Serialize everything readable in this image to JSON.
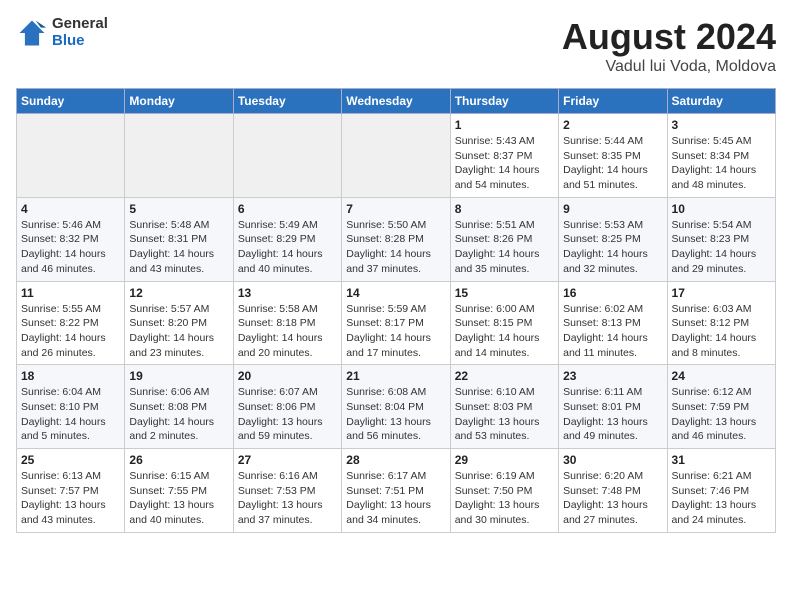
{
  "logo": {
    "general": "General",
    "blue": "Blue"
  },
  "title": "August 2024",
  "subtitle": "Vadul lui Voda, Moldova",
  "headers": [
    "Sunday",
    "Monday",
    "Tuesday",
    "Wednesday",
    "Thursday",
    "Friday",
    "Saturday"
  ],
  "weeks": [
    [
      {
        "num": "",
        "info": ""
      },
      {
        "num": "",
        "info": ""
      },
      {
        "num": "",
        "info": ""
      },
      {
        "num": "",
        "info": ""
      },
      {
        "num": "1",
        "info": "Sunrise: 5:43 AM\nSunset: 8:37 PM\nDaylight: 14 hours\nand 54 minutes."
      },
      {
        "num": "2",
        "info": "Sunrise: 5:44 AM\nSunset: 8:35 PM\nDaylight: 14 hours\nand 51 minutes."
      },
      {
        "num": "3",
        "info": "Sunrise: 5:45 AM\nSunset: 8:34 PM\nDaylight: 14 hours\nand 48 minutes."
      }
    ],
    [
      {
        "num": "4",
        "info": "Sunrise: 5:46 AM\nSunset: 8:32 PM\nDaylight: 14 hours\nand 46 minutes."
      },
      {
        "num": "5",
        "info": "Sunrise: 5:48 AM\nSunset: 8:31 PM\nDaylight: 14 hours\nand 43 minutes."
      },
      {
        "num": "6",
        "info": "Sunrise: 5:49 AM\nSunset: 8:29 PM\nDaylight: 14 hours\nand 40 minutes."
      },
      {
        "num": "7",
        "info": "Sunrise: 5:50 AM\nSunset: 8:28 PM\nDaylight: 14 hours\nand 37 minutes."
      },
      {
        "num": "8",
        "info": "Sunrise: 5:51 AM\nSunset: 8:26 PM\nDaylight: 14 hours\nand 35 minutes."
      },
      {
        "num": "9",
        "info": "Sunrise: 5:53 AM\nSunset: 8:25 PM\nDaylight: 14 hours\nand 32 minutes."
      },
      {
        "num": "10",
        "info": "Sunrise: 5:54 AM\nSunset: 8:23 PM\nDaylight: 14 hours\nand 29 minutes."
      }
    ],
    [
      {
        "num": "11",
        "info": "Sunrise: 5:55 AM\nSunset: 8:22 PM\nDaylight: 14 hours\nand 26 minutes."
      },
      {
        "num": "12",
        "info": "Sunrise: 5:57 AM\nSunset: 8:20 PM\nDaylight: 14 hours\nand 23 minutes."
      },
      {
        "num": "13",
        "info": "Sunrise: 5:58 AM\nSunset: 8:18 PM\nDaylight: 14 hours\nand 20 minutes."
      },
      {
        "num": "14",
        "info": "Sunrise: 5:59 AM\nSunset: 8:17 PM\nDaylight: 14 hours\nand 17 minutes."
      },
      {
        "num": "15",
        "info": "Sunrise: 6:00 AM\nSunset: 8:15 PM\nDaylight: 14 hours\nand 14 minutes."
      },
      {
        "num": "16",
        "info": "Sunrise: 6:02 AM\nSunset: 8:13 PM\nDaylight: 14 hours\nand 11 minutes."
      },
      {
        "num": "17",
        "info": "Sunrise: 6:03 AM\nSunset: 8:12 PM\nDaylight: 14 hours\nand 8 minutes."
      }
    ],
    [
      {
        "num": "18",
        "info": "Sunrise: 6:04 AM\nSunset: 8:10 PM\nDaylight: 14 hours\nand 5 minutes."
      },
      {
        "num": "19",
        "info": "Sunrise: 6:06 AM\nSunset: 8:08 PM\nDaylight: 14 hours\nand 2 minutes."
      },
      {
        "num": "20",
        "info": "Sunrise: 6:07 AM\nSunset: 8:06 PM\nDaylight: 13 hours\nand 59 minutes."
      },
      {
        "num": "21",
        "info": "Sunrise: 6:08 AM\nSunset: 8:04 PM\nDaylight: 13 hours\nand 56 minutes."
      },
      {
        "num": "22",
        "info": "Sunrise: 6:10 AM\nSunset: 8:03 PM\nDaylight: 13 hours\nand 53 minutes."
      },
      {
        "num": "23",
        "info": "Sunrise: 6:11 AM\nSunset: 8:01 PM\nDaylight: 13 hours\nand 49 minutes."
      },
      {
        "num": "24",
        "info": "Sunrise: 6:12 AM\nSunset: 7:59 PM\nDaylight: 13 hours\nand 46 minutes."
      }
    ],
    [
      {
        "num": "25",
        "info": "Sunrise: 6:13 AM\nSunset: 7:57 PM\nDaylight: 13 hours\nand 43 minutes."
      },
      {
        "num": "26",
        "info": "Sunrise: 6:15 AM\nSunset: 7:55 PM\nDaylight: 13 hours\nand 40 minutes."
      },
      {
        "num": "27",
        "info": "Sunrise: 6:16 AM\nSunset: 7:53 PM\nDaylight: 13 hours\nand 37 minutes."
      },
      {
        "num": "28",
        "info": "Sunrise: 6:17 AM\nSunset: 7:51 PM\nDaylight: 13 hours\nand 34 minutes."
      },
      {
        "num": "29",
        "info": "Sunrise: 6:19 AM\nSunset: 7:50 PM\nDaylight: 13 hours\nand 30 minutes."
      },
      {
        "num": "30",
        "info": "Sunrise: 6:20 AM\nSunset: 7:48 PM\nDaylight: 13 hours\nand 27 minutes."
      },
      {
        "num": "31",
        "info": "Sunrise: 6:21 AM\nSunset: 7:46 PM\nDaylight: 13 hours\nand 24 minutes."
      }
    ]
  ]
}
